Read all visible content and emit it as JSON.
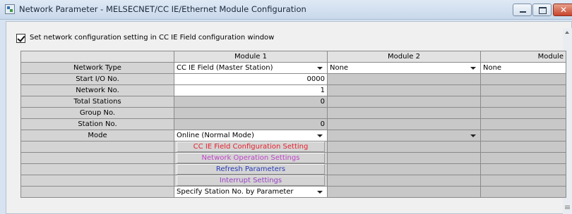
{
  "window": {
    "title": "Network Parameter - MELSECNET/CC IE/Ethernet Module Configuration"
  },
  "options": {
    "set_network_config_label": "Set network configuration setting in CC IE Field configuration window",
    "set_network_config_checked": true
  },
  "table": {
    "columns": [
      "Module 1",
      "Module 2",
      "Module"
    ],
    "rows": {
      "network_type": {
        "label": "Network Type",
        "module1": "CC IE Field (Master Station)",
        "module2": "None",
        "module3": "None"
      },
      "start_io": {
        "label": "Start I/O No.",
        "module1": "0000"
      },
      "network_no": {
        "label": "Network No.",
        "module1": "1"
      },
      "total_stations": {
        "label": "Total Stations",
        "module1": "0"
      },
      "group_no": {
        "label": "Group No.",
        "module1": ""
      },
      "station_no": {
        "label": "Station No.",
        "module1": "0"
      },
      "mode": {
        "label": "Mode",
        "module1": "Online (Normal Mode)"
      }
    },
    "buttons": {
      "cc_ie_config": "CC IE Field Configuration Setting",
      "network_operation": "Network Operation Settings",
      "refresh_params": "Refresh Parameters",
      "interrupt": "Interrupt Settings"
    },
    "station_no_method": "Specify Station No. by Parameter"
  },
  "colors": {
    "cc_ie_config": "#e8212d",
    "network_operation": "#c043c8",
    "refresh_params": "#2a3ab8",
    "interrupt": "#9a44c4"
  },
  "icons": [
    "network-parameter-app-icon",
    "minimize-icon",
    "maximize-icon",
    "close-icon",
    "checkbox-checked-icon",
    "dropdown-arrow-icon",
    "scroll-up-arrow-icon",
    "scroll-grip-icon"
  ]
}
